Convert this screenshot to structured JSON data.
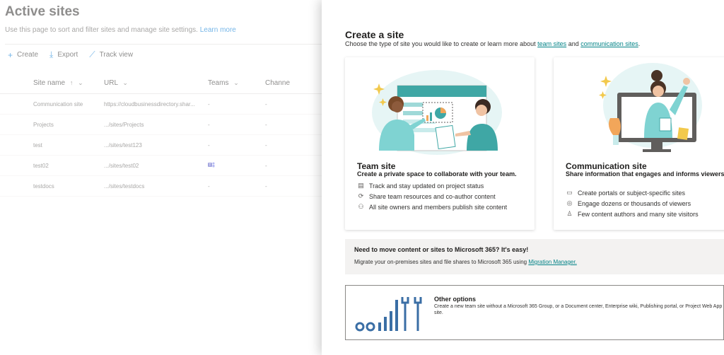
{
  "background": {
    "title": "Active sites",
    "description": "Use this page to sort and filter sites and manage site settings.",
    "learn_more": "Learn more",
    "commands": [
      {
        "label": "Create",
        "icon": "plus-icon"
      },
      {
        "label": "Export",
        "icon": "download-icon"
      },
      {
        "label": "Track view",
        "icon": "chart-icon"
      }
    ],
    "columns": [
      "Site name",
      "URL",
      "Teams",
      "Channe"
    ],
    "sort_indicator": "↑",
    "rows": [
      {
        "name": "Communication site",
        "url": "https://cloudbusinessdirectory.shar...",
        "teams": "-",
        "channel": "-"
      },
      {
        "name": "Projects",
        "url": ".../sites/Projects",
        "teams": "-",
        "channel": "-"
      },
      {
        "name": "test",
        "url": ".../sites/test123",
        "teams": "-",
        "channel": "-"
      },
      {
        "name": "test02",
        "url": ".../sites/test02",
        "teams": "teams-icon",
        "channel": "-"
      },
      {
        "name": "testdocs",
        "url": ".../sites/testdocs",
        "teams": "-",
        "channel": "-"
      }
    ]
  },
  "panel": {
    "title": "Create a site",
    "subtitle_prefix": "Choose the type of site you would like to create or learn more about",
    "link_team": "team sites",
    "subtitle_and": "and",
    "link_comm": "communication sites",
    "subtitle_end": ".",
    "team_card": {
      "title": "Team site",
      "description": "Create a private space to collaborate with your team.",
      "features": [
        {
          "icon": "clipboard-icon",
          "text": "Track and stay updated on project status"
        },
        {
          "icon": "sync-icon",
          "text": "Share team resources and co-author content"
        },
        {
          "icon": "people-icon",
          "text": "All site owners and members publish site content"
        }
      ]
    },
    "comm_card": {
      "title": "Communication site",
      "description": "Share information that engages and informs viewers.",
      "features": [
        {
          "icon": "portal-icon",
          "text": "Create portals or subject-specific sites"
        },
        {
          "icon": "broadcast-icon",
          "text": "Engage dozens or thousands of viewers"
        },
        {
          "icon": "person-edit-icon",
          "text": "Few content authors and many site visitors"
        }
      ]
    },
    "migration": {
      "title": "Need to move content or sites to Microsoft 365? It's easy!",
      "text": "Migrate your on-premises sites and file shares to Microsoft 365 using",
      "link": "Migration Manager."
    },
    "other": {
      "title": "Other options",
      "text": "Create a new team site without a Microsoft 365 Group, or a Document center, Enterprise wiki, Publishing portal, or Project Web App site."
    }
  },
  "colors": {
    "accent": "#0078d4",
    "teal": "#038387",
    "teal_light": "#7fd3d2"
  }
}
